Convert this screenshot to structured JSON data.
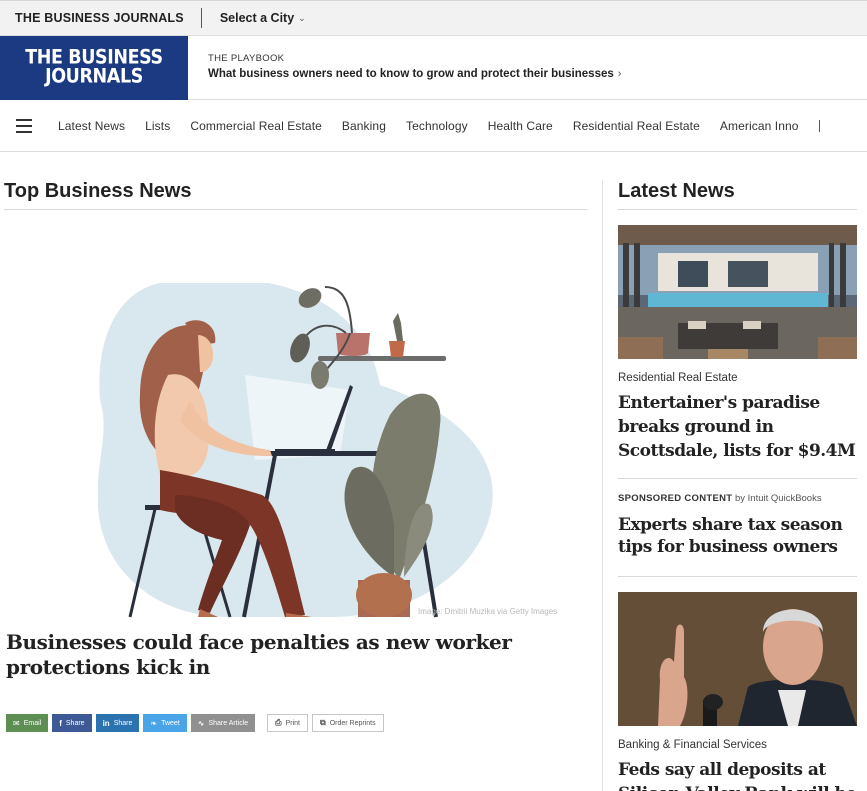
{
  "topbar": {
    "brand": "THE BUSINESS JOURNALS",
    "city_label": "Select a City"
  },
  "masthead": {
    "logo_line1": "THE BUSINESS",
    "logo_line2": "JOURNALS",
    "kicker": "THE PLAYBOOK",
    "headline": "What business owners need to know to grow and protect their businesses"
  },
  "nav": {
    "items": [
      "Latest News",
      "Lists",
      "Commercial Real Estate",
      "Banking",
      "Technology",
      "Health Care",
      "Residential Real Estate",
      "American Inno"
    ]
  },
  "main": {
    "section_title": "Top Business News",
    "image_credit": "Image: Dmitrii Muzika via Getty Images",
    "story_headline": "Businesses could face penalties as new worker protections kick in",
    "share": {
      "email": "Email",
      "facebook": "Share",
      "linkedin": "Share",
      "twitter": "Tweet",
      "share_article": "Share Article",
      "print": "Print",
      "reprints": "Order Reprints"
    }
  },
  "sidebar": {
    "section_title": "Latest News",
    "story1": {
      "category": "Residential Real Estate",
      "headline": "Entertainer's paradise breaks ground in Scottsdale, lists for $9.4M"
    },
    "sponsored": {
      "label": "SPONSORED CONTENT",
      "by": "by Intuit QuickBooks",
      "headline": "Experts share tax season tips for business owners"
    },
    "story2": {
      "category": "Banking & Financial Services",
      "headline": "Feds say all deposits at Silicon Valley Bank will be"
    }
  },
  "colors": {
    "logo_bg": "#1b3a82",
    "email_btn": "#5d8e54",
    "facebook_btn": "#3d5a97",
    "linkedin_btn": "#2a73b0",
    "twitter_btn": "#4aa4e8"
  }
}
